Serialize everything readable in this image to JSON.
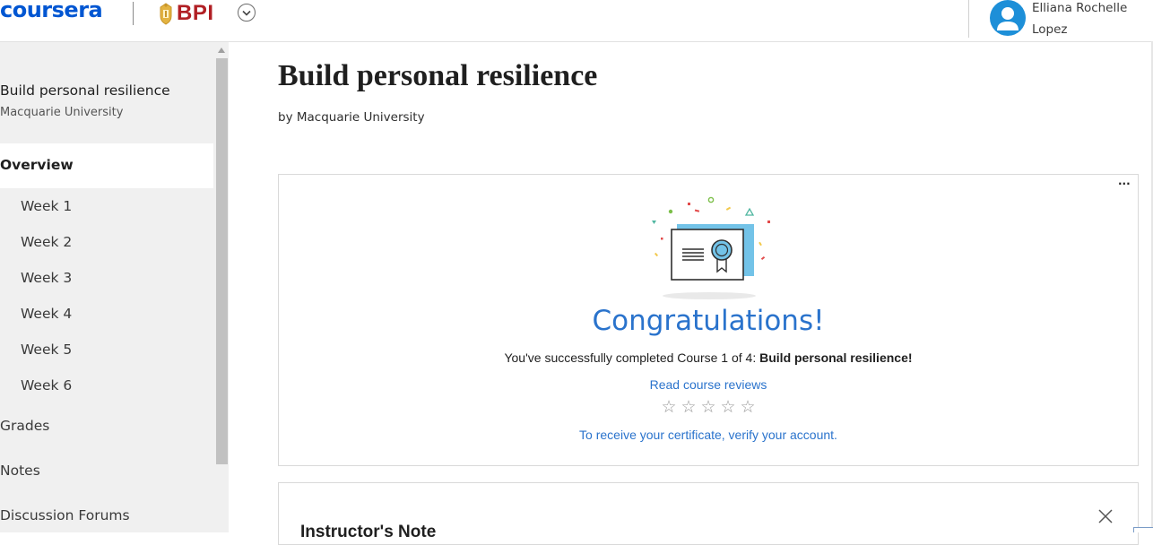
{
  "header": {
    "coursera_logo": "coursera",
    "partner_logo": "BPI",
    "user_name": "Elliana Rochelle Lopez",
    "icons": {
      "switcher": "chevron-down-icon",
      "avatar": "user-avatar-icon"
    }
  },
  "sidebar": {
    "course_title": "Build personal resilience",
    "course_org": "Macquarie University",
    "active_item": "Overview",
    "weeks": [
      "Week 1",
      "Week 2",
      "Week 3",
      "Week 4",
      "Week 5",
      "Week 6"
    ],
    "items": [
      "Grades",
      "Notes",
      "Discussion Forums"
    ]
  },
  "main": {
    "title": "Build personal resilience",
    "byline": "by Macquarie University",
    "completion_card": {
      "more_label": "...",
      "congrats": "Congratulations!",
      "message_prefix": "You've successfully completed Course 1 of 4: ",
      "message_course": "Build personal resilience",
      "message_suffix": "!",
      "reviews_link": "Read course reviews",
      "rating_stars": 5,
      "rating_value": 0,
      "verify_link": "To receive your certificate, verify your account."
    },
    "note_card": {
      "title": "Instructor's Note"
    }
  },
  "colors": {
    "brand_blue": "#0056d2",
    "link_blue": "#2a73cc",
    "bpi_red": "#b11f24",
    "sidebar_bg": "#f0f0f0",
    "avatar_bg": "#1d8fd8"
  }
}
